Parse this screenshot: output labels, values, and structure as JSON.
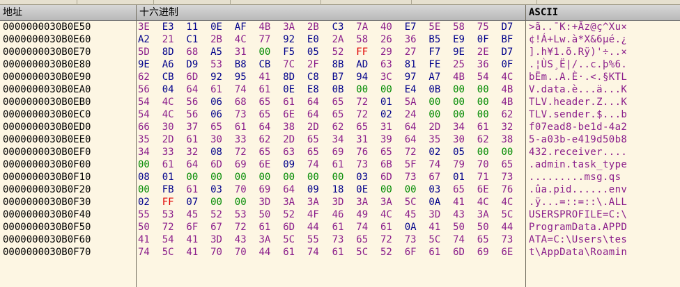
{
  "columns": {
    "address": "地址",
    "hex": "十六进制",
    "ascii": "ASCII"
  },
  "colors": {
    "printable": "#8b1e8b",
    "zero": "#008a00",
    "ff": "#e00000",
    "other": "#00008b"
  },
  "rows": [
    {
      "addr": "0000000030B0E50",
      "bytes": [
        "3E",
        "E3",
        "11",
        "0E",
        "AF",
        "4B",
        "3A",
        "2B",
        "C3",
        "7A",
        "40",
        "E7",
        "5E",
        "58",
        "75",
        "D7"
      ],
      "ascii": ">ã..¯K:+Ãz@ç^Xu×"
    },
    {
      "addr": "0000000030B0E60",
      "bytes": [
        "A2",
        "21",
        "C1",
        "2B",
        "4C",
        "77",
        "92",
        "E0",
        "2A",
        "58",
        "26",
        "36",
        "B5",
        "E9",
        "0F",
        "BF"
      ],
      "ascii": "¢!Á+Lw.à*X&6µé.¿"
    },
    {
      "addr": "0000000030B0E70",
      "bytes": [
        "5D",
        "8D",
        "68",
        "A5",
        "31",
        "00",
        "F5",
        "05",
        "52",
        "FF",
        "29",
        "27",
        "F7",
        "9E",
        "2E",
        "D7"
      ],
      "ascii": "].h¥1.õ.Rÿ)'÷..×"
    },
    {
      "addr": "0000000030B0E80",
      "bytes": [
        "9E",
        "A6",
        "D9",
        "53",
        "B8",
        "CB",
        "7C",
        "2F",
        "8B",
        "AD",
        "63",
        "81",
        "FE",
        "25",
        "36",
        "0F"
      ],
      "ascii": ".¦ÙS¸Ë|/..c.þ%6."
    },
    {
      "addr": "0000000030B0E90",
      "bytes": [
        "62",
        "CB",
        "6D",
        "92",
        "95",
        "41",
        "8D",
        "C8",
        "B7",
        "94",
        "3C",
        "97",
        "A7",
        "4B",
        "54",
        "4C"
      ],
      "ascii": "bËm..A.È·.<.§KTL"
    },
    {
      "addr": "0000000030B0EA0",
      "bytes": [
        "56",
        "04",
        "64",
        "61",
        "74",
        "61",
        "0E",
        "E8",
        "0B",
        "00",
        "00",
        "E4",
        "0B",
        "00",
        "00",
        "4B"
      ],
      "ascii": "V.data.è...ä...K"
    },
    {
      "addr": "0000000030B0EB0",
      "bytes": [
        "54",
        "4C",
        "56",
        "06",
        "68",
        "65",
        "61",
        "64",
        "65",
        "72",
        "01",
        "5A",
        "00",
        "00",
        "00",
        "4B"
      ],
      "ascii": "TLV.header.Z...K"
    },
    {
      "addr": "0000000030B0EC0",
      "bytes": [
        "54",
        "4C",
        "56",
        "06",
        "73",
        "65",
        "6E",
        "64",
        "65",
        "72",
        "02",
        "24",
        "00",
        "00",
        "00",
        "62"
      ],
      "ascii": "TLV.sender.$...b"
    },
    {
      "addr": "0000000030B0ED0",
      "bytes": [
        "66",
        "30",
        "37",
        "65",
        "61",
        "64",
        "38",
        "2D",
        "62",
        "65",
        "31",
        "64",
        "2D",
        "34",
        "61",
        "32"
      ],
      "ascii": "f07ead8-be1d-4a2"
    },
    {
      "addr": "0000000030B0EE0",
      "bytes": [
        "35",
        "2D",
        "61",
        "30",
        "33",
        "62",
        "2D",
        "65",
        "34",
        "31",
        "39",
        "64",
        "35",
        "30",
        "62",
        "38"
      ],
      "ascii": "5-a03b-e419d50b8"
    },
    {
      "addr": "0000000030B0EF0",
      "bytes": [
        "34",
        "33",
        "32",
        "08",
        "72",
        "65",
        "63",
        "65",
        "69",
        "76",
        "65",
        "72",
        "02",
        "05",
        "00",
        "00"
      ],
      "ascii": "432.receiver...."
    },
    {
      "addr": "0000000030B0F00",
      "bytes": [
        "00",
        "61",
        "64",
        "6D",
        "69",
        "6E",
        "09",
        "74",
        "61",
        "73",
        "6B",
        "5F",
        "74",
        "79",
        "70",
        "65"
      ],
      "ascii": ".admin.task_type"
    },
    {
      "addr": "0000000030B0F10",
      "bytes": [
        "08",
        "01",
        "00",
        "00",
        "00",
        "00",
        "00",
        "00",
        "00",
        "03",
        "6D",
        "73",
        "67",
        "01",
        "71",
        "73"
      ],
      "ascii": ".........msg.qs"
    },
    {
      "addr": "0000000030B0F20",
      "bytes": [
        "00",
        "FB",
        "61",
        "03",
        "70",
        "69",
        "64",
        "09",
        "18",
        "0E",
        "00",
        "00",
        "03",
        "65",
        "6E",
        "76"
      ],
      "ascii": ".ûa.pid......env"
    },
    {
      "addr": "0000000030B0F30",
      "bytes": [
        "02",
        "FF",
        "07",
        "00",
        "00",
        "3D",
        "3A",
        "3A",
        "3D",
        "3A",
        "3A",
        "5C",
        "0A",
        "41",
        "4C",
        "4C"
      ],
      "ascii": ".ÿ...=::=::\\.ALL"
    },
    {
      "addr": "0000000030B0F40",
      "bytes": [
        "55",
        "53",
        "45",
        "52",
        "53",
        "50",
        "52",
        "4F",
        "46",
        "49",
        "4C",
        "45",
        "3D",
        "43",
        "3A",
        "5C"
      ],
      "ascii": "USERSPROFILE=C:\\"
    },
    {
      "addr": "0000000030B0F50",
      "bytes": [
        "50",
        "72",
        "6F",
        "67",
        "72",
        "61",
        "6D",
        "44",
        "61",
        "74",
        "61",
        "0A",
        "41",
        "50",
        "50",
        "44"
      ],
      "ascii": "ProgramData.APPD"
    },
    {
      "addr": "0000000030B0F60",
      "bytes": [
        "41",
        "54",
        "41",
        "3D",
        "43",
        "3A",
        "5C",
        "55",
        "73",
        "65",
        "72",
        "73",
        "5C",
        "74",
        "65",
        "73"
      ],
      "ascii": "ATA=C:\\Users\\tes"
    },
    {
      "addr": "0000000030B0F70",
      "bytes": [
        "74",
        "5C",
        "41",
        "70",
        "70",
        "44",
        "61",
        "74",
        "61",
        "5C",
        "52",
        "6F",
        "61",
        "6D",
        "69",
        "6E"
      ],
      "ascii": "t\\AppData\\Roamin"
    }
  ]
}
